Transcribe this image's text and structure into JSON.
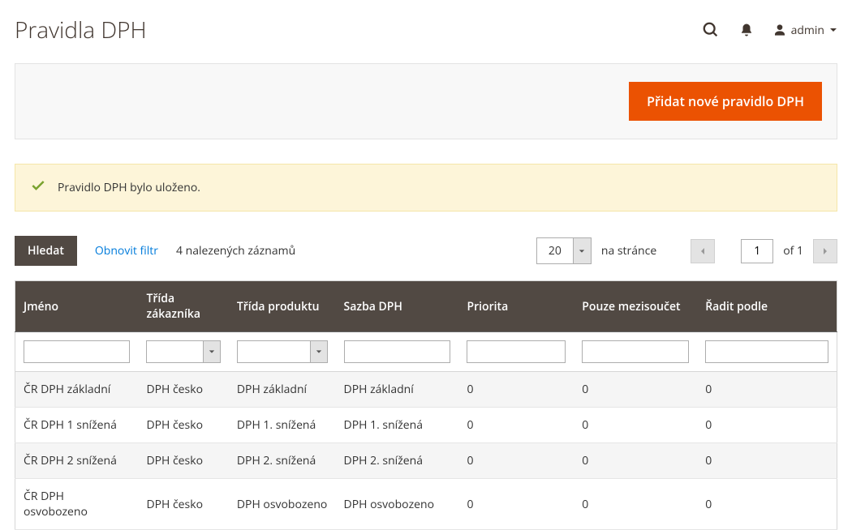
{
  "header": {
    "title": "Pravidla DPH",
    "user_label": "admin"
  },
  "toolbar": {
    "add_button": "Přidat nové pravidlo DPH"
  },
  "message": {
    "text": "Pravidlo DPH bylo uloženo."
  },
  "controls": {
    "search_label": "Hledat",
    "reset_label": "Obnovit filtr",
    "records_text": "4 nalezených záznamů",
    "page_size": "20",
    "per_page_label": "na stránce",
    "current_page": "1",
    "of_label": "of",
    "total_pages": "1"
  },
  "grid": {
    "columns": {
      "name": "Jméno",
      "customer_class": "Třída zákazníka",
      "product_class": "Třída produktu",
      "rate": "Sazba DPH",
      "priority": "Priorita",
      "subtotal_only": "Pouze mezisoučet",
      "sort_order": "Řadit podle"
    },
    "rows": [
      {
        "name": "ČR DPH základní",
        "customer_class": "DPH česko",
        "product_class": "DPH základní",
        "rate": "DPH základní",
        "priority": "0",
        "subtotal_only": "0",
        "sort_order": "0"
      },
      {
        "name": "ČR DPH 1 snížená",
        "customer_class": "DPH česko",
        "product_class": "DPH 1. snížená",
        "rate": "DPH 1. snížená",
        "priority": "0",
        "subtotal_only": "0",
        "sort_order": "0"
      },
      {
        "name": "ČR DPH 2 snížená",
        "customer_class": "DPH česko",
        "product_class": "DPH 2. snížená",
        "rate": "DPH 2. snížená",
        "priority": "0",
        "subtotal_only": "0",
        "sort_order": "0"
      },
      {
        "name": "ČR DPH osvobozeno",
        "customer_class": "DPH česko",
        "product_class": "DPH osvobozeno",
        "rate": "DPH osvobozeno",
        "priority": "0",
        "subtotal_only": "0",
        "sort_order": "0"
      }
    ]
  }
}
